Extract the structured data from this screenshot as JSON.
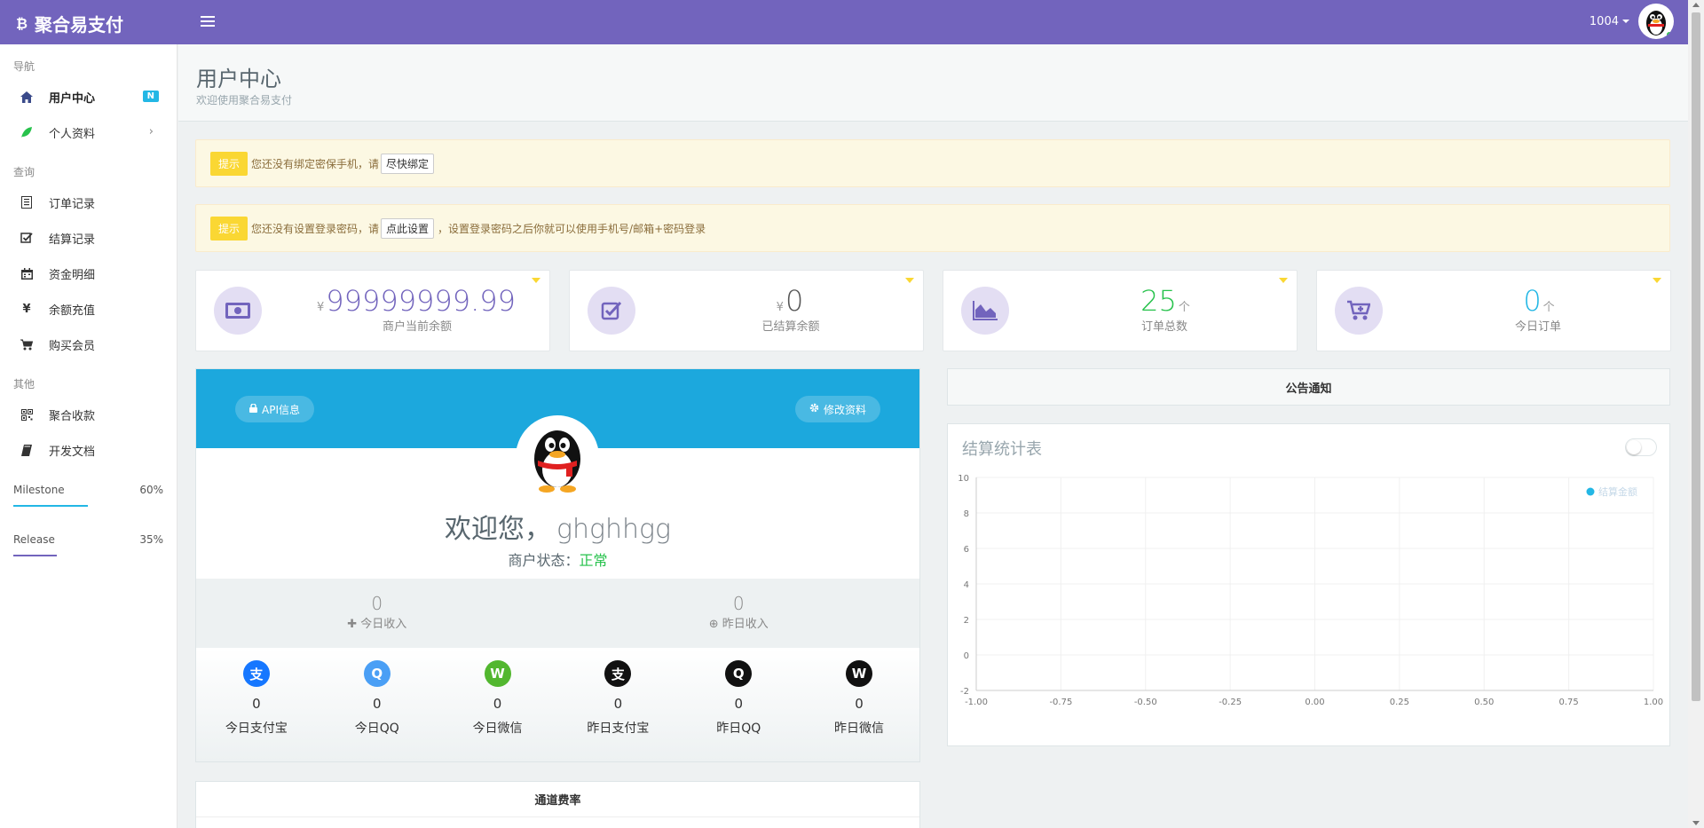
{
  "header": {
    "brand": "聚合易支付",
    "user_id": "1004"
  },
  "sidebar": {
    "section_nav": "导航",
    "section_query": "查询",
    "section_other": "其他",
    "items": [
      {
        "label": "用户中心",
        "badge": "N",
        "icon": "home-icon"
      },
      {
        "label": "个人资料",
        "icon": "leaf-icon"
      },
      {
        "label": "订单记录",
        "icon": "list-icon"
      },
      {
        "label": "结算记录",
        "icon": "check-square-icon"
      },
      {
        "label": "资金明细",
        "icon": "calendar-icon"
      },
      {
        "label": "余额充值",
        "icon": "yen-icon"
      },
      {
        "label": "购买会员",
        "icon": "cart-icon"
      },
      {
        "label": "聚合收款",
        "icon": "qrcode-icon"
      },
      {
        "label": "开发文档",
        "icon": "book-icon"
      }
    ],
    "progress": [
      {
        "label": "Milestone",
        "value_text": "60%",
        "value": 0.6,
        "color": "#23b7e5"
      },
      {
        "label": "Release",
        "value_text": "35%",
        "value": 0.35,
        "color": "#7264bd"
      }
    ]
  },
  "page": {
    "title": "用户中心",
    "subtitle": "欢迎使用聚合易支付"
  },
  "alerts": [
    {
      "tag": "提示",
      "text_before": "您还没有绑定密保手机，请",
      "button": "尽快绑定",
      "text_after": ""
    },
    {
      "tag": "提示",
      "text_before": "您还没有设置登录密码，请",
      "button": "点此设置",
      "text_after": "，设置登录密码之后你就可以使用手机号/邮箱+密码登录"
    }
  ],
  "stats": [
    {
      "prefix": "¥",
      "value": "99999999.99",
      "suffix": "",
      "label": "商户当前余额",
      "color": "#7264bd"
    },
    {
      "prefix": "¥",
      "value": "0",
      "suffix": "",
      "label": "已结算余额",
      "color": "#555555"
    },
    {
      "prefix": "",
      "value": "25",
      "suffix": "个",
      "label": "订单总数",
      "color": "#27c24c"
    },
    {
      "prefix": "",
      "value": "0",
      "suffix": "个",
      "label": "今日订单",
      "color": "#23b7e5"
    }
  ],
  "profile": {
    "api_button": "API信息",
    "edit_button": "修改资料",
    "welcome": "欢迎您，",
    "username": "ghghhgg",
    "status_label": "商户状态：",
    "status_value": "正常",
    "today_income_value": "0",
    "today_income_label": "今日收入",
    "yesterday_income_value": "0",
    "yesterday_income_label": "昨日收入",
    "channels": [
      {
        "label": "今日支付宝",
        "value": "0",
        "icon": "alipay-icon",
        "glyph": "支",
        "color": "#1677ff"
      },
      {
        "label": "今日QQ",
        "value": "0",
        "icon": "qq-icon",
        "glyph": "Q",
        "color": "#4a9ff5"
      },
      {
        "label": "今日微信",
        "value": "0",
        "icon": "wechat-icon",
        "glyph": "W",
        "color": "#52b72f"
      },
      {
        "label": "昨日支付宝",
        "value": "0",
        "icon": "alipay-icon",
        "glyph": "支",
        "color": "#111111"
      },
      {
        "label": "昨日QQ",
        "value": "0",
        "icon": "qq-icon",
        "glyph": "Q",
        "color": "#111111"
      },
      {
        "label": "昨日微信",
        "value": "0",
        "icon": "wechat-icon",
        "glyph": "W",
        "color": "#111111"
      }
    ]
  },
  "rate_panel": {
    "title": "通道费率"
  },
  "notice": {
    "title": "公告通知"
  },
  "chart_data": {
    "type": "line",
    "title": "结算统计表",
    "series": [
      {
        "name": "结算金额",
        "values": []
      }
    ],
    "x_ticks": [
      "-1.00",
      "-0.75",
      "-0.50",
      "-0.25",
      "0.00",
      "0.25",
      "0.50",
      "0.75",
      "1.00"
    ],
    "y_ticks": [
      "10",
      "8",
      "6",
      "4",
      "2",
      "0",
      "-2"
    ],
    "xlim": [
      -1,
      1
    ],
    "ylim": [
      -2,
      10
    ],
    "grid": true,
    "legend": "top-right",
    "series_color": "#23b7e5"
  }
}
